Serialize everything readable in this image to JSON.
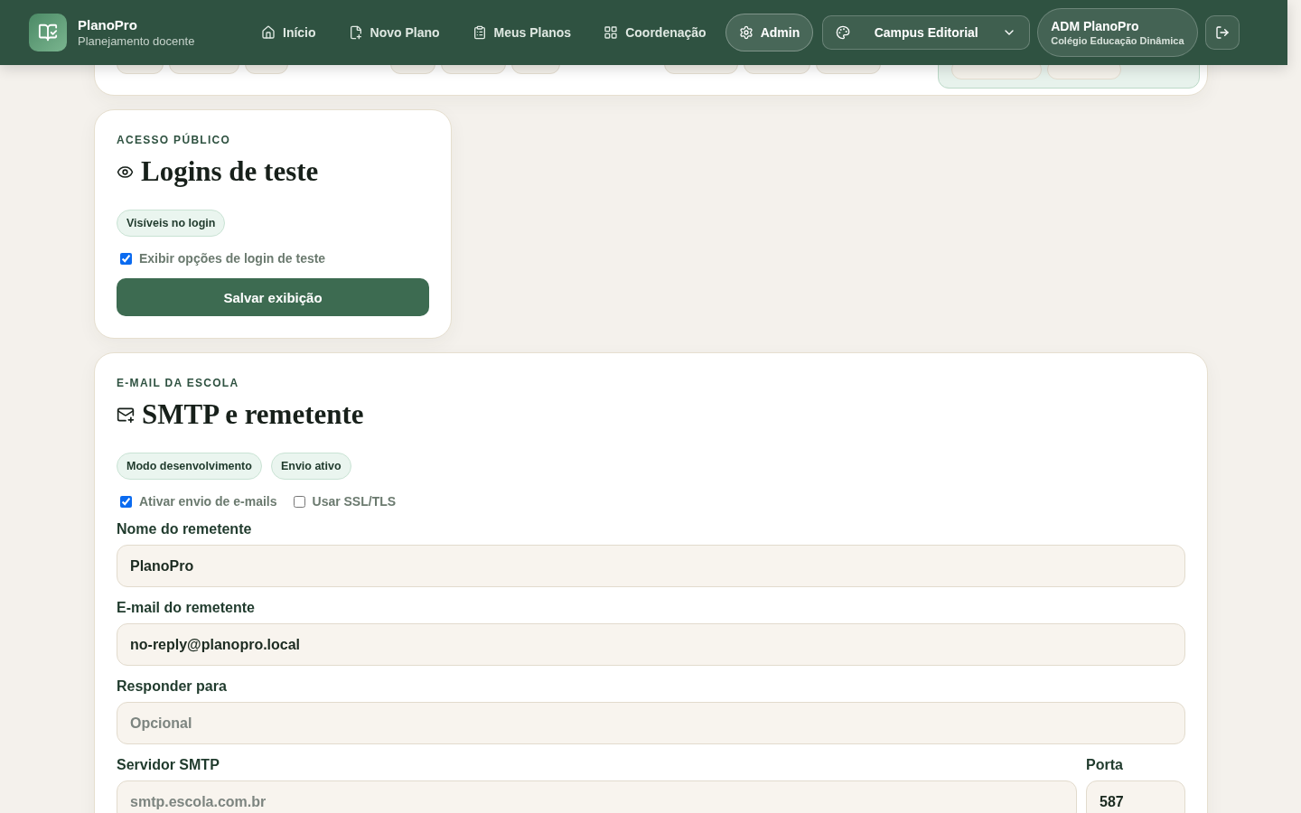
{
  "header": {
    "brand": "PlanoPro",
    "subtitle": "Planejamento docente",
    "nav": [
      {
        "label": "Início",
        "selected": false
      },
      {
        "label": "Novo Plano",
        "selected": false
      },
      {
        "label": "Meus Planos",
        "selected": false
      },
      {
        "label": "Coordenação",
        "selected": false
      },
      {
        "label": "Admin",
        "selected": true
      }
    ],
    "theme_select": {
      "value": "Campus Editorial"
    },
    "user": {
      "name": "ADM PlanoPro",
      "school": "Colégio Educação Dinâmica"
    }
  },
  "login_card": {
    "eyebrow": "ACESSO PÚBLICO",
    "title": "Logins de teste",
    "badges": [
      "Visíveis no login"
    ],
    "checkboxes": [
      {
        "label": "Exibir opções de login de teste",
        "checked": true
      }
    ],
    "button": "Salvar exibição"
  },
  "email_card": {
    "eyebrow": "E-MAIL DA ESCOLA",
    "title": "SMTP e remetente",
    "badges": [
      "Modo desenvolvimento",
      "Envio ativo"
    ],
    "checkboxes": [
      {
        "label": "Ativar envio de e-mails",
        "checked": true
      },
      {
        "label": "Usar SSL/TLS",
        "checked": false
      }
    ],
    "fields": [
      {
        "label": "Nome do remetente",
        "value": "PlanoPro"
      },
      {
        "label": "E-mail do remetente",
        "value": "no-reply@planopro.local"
      },
      {
        "label": "Responder para",
        "placeholder": "Opcional"
      }
    ],
    "server_row": [
      {
        "label": "Servidor SMTP",
        "placeholder": "smtp.escola.com.br"
      },
      {
        "label": "Porta",
        "value": "587"
      }
    ]
  }
}
